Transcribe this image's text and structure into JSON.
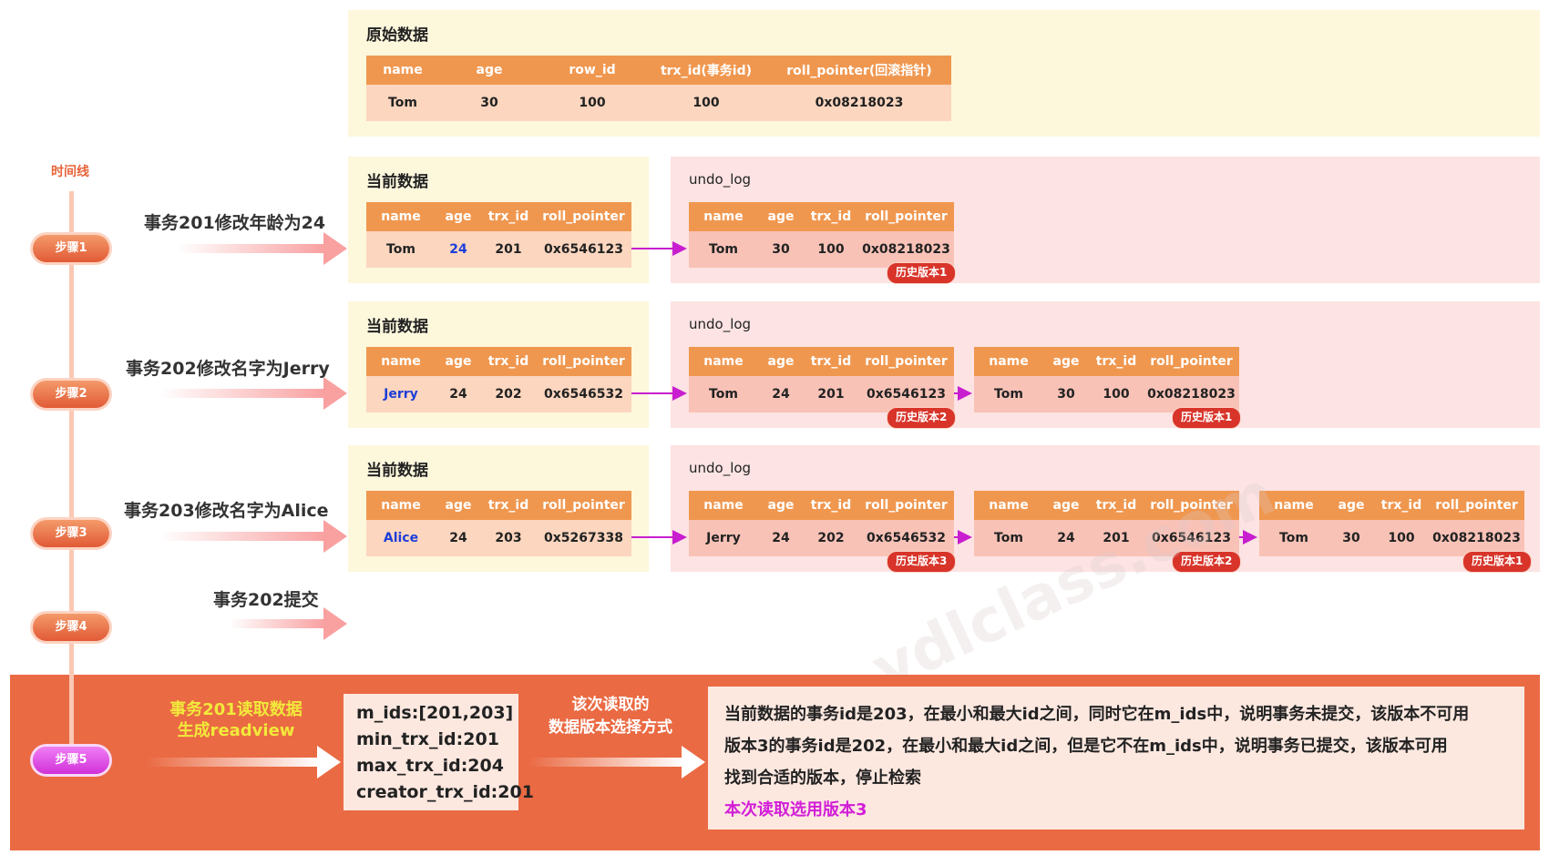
{
  "original": {
    "title": "原始数据",
    "headers": [
      "name",
      "age",
      "row_id",
      "trx_id(事务id)",
      "roll_pointer(回滚指针)"
    ],
    "row": [
      "Tom",
      "30",
      "100",
      "100",
      "0x08218023"
    ]
  },
  "timeline": {
    "label": "时间线"
  },
  "steps": [
    {
      "label": "步骤1",
      "caption": "事务201修改年龄为24"
    },
    {
      "label": "步骤2",
      "caption": "事务202修改名字为Jerry"
    },
    {
      "label": "步骤3",
      "caption": "事务203修改名字为Alice"
    },
    {
      "label": "步骤4",
      "caption": "事务202提交"
    },
    {
      "label": "步骤5",
      "caption_line1": "事务201读取数据",
      "caption_line2": "生成readview"
    }
  ],
  "current_title": "当前数据",
  "undo_title": "undo_log",
  "headers4": [
    "name",
    "age",
    "trx_id",
    "roll_pointer"
  ],
  "step1": {
    "current": [
      "Tom",
      "24",
      "201",
      "0x6546123"
    ],
    "undo": [
      {
        "row": [
          "Tom",
          "30",
          "100",
          "0x08218023"
        ],
        "badge": "历史版本1"
      }
    ]
  },
  "step2": {
    "current": [
      "Jerry",
      "24",
      "202",
      "0x6546532"
    ],
    "undo": [
      {
        "row": [
          "Tom",
          "24",
          "201",
          "0x6546123"
        ],
        "badge": "历史版本2"
      },
      {
        "row": [
          "Tom",
          "30",
          "100",
          "0x08218023"
        ],
        "badge": "历史版本1"
      }
    ]
  },
  "step3": {
    "current": [
      "Alice",
      "24",
      "203",
      "0x5267338"
    ],
    "undo": [
      {
        "row": [
          "Jerry",
          "24",
          "202",
          "0x6546532"
        ],
        "badge": "历史版本3"
      },
      {
        "row": [
          "Tom",
          "24",
          "201",
          "0x6546123"
        ],
        "badge": "历史版本2"
      },
      {
        "row": [
          "Tom",
          "30",
          "100",
          "0x08218023"
        ],
        "badge": "历史版本1"
      }
    ]
  },
  "readview": [
    "m_ids:[201,203]",
    "min_trx_id:201",
    "max_trx_id:204",
    "creator_trx_id:201"
  ],
  "mid_label": {
    "line1": "该次读取的",
    "line2": "数据版本选择方式"
  },
  "conclusion": [
    "当前数据的事务id是203，在最小和最大id之间，同时它在m_ids中，说明事务未提交，该版本不可用",
    "版本3的事务id是202，在最小和最大id之间，但是它不在m_ids中，说明事务已提交，该版本可用",
    "找到合适的版本，停止检索",
    "本次读取选用版本3"
  ],
  "watermark": "ydlclass.com",
  "colors": {
    "accent": "#ea6a43",
    "header": "#f0974f",
    "pointer": "#c81ecf",
    "yellow": "#f2e93b"
  }
}
